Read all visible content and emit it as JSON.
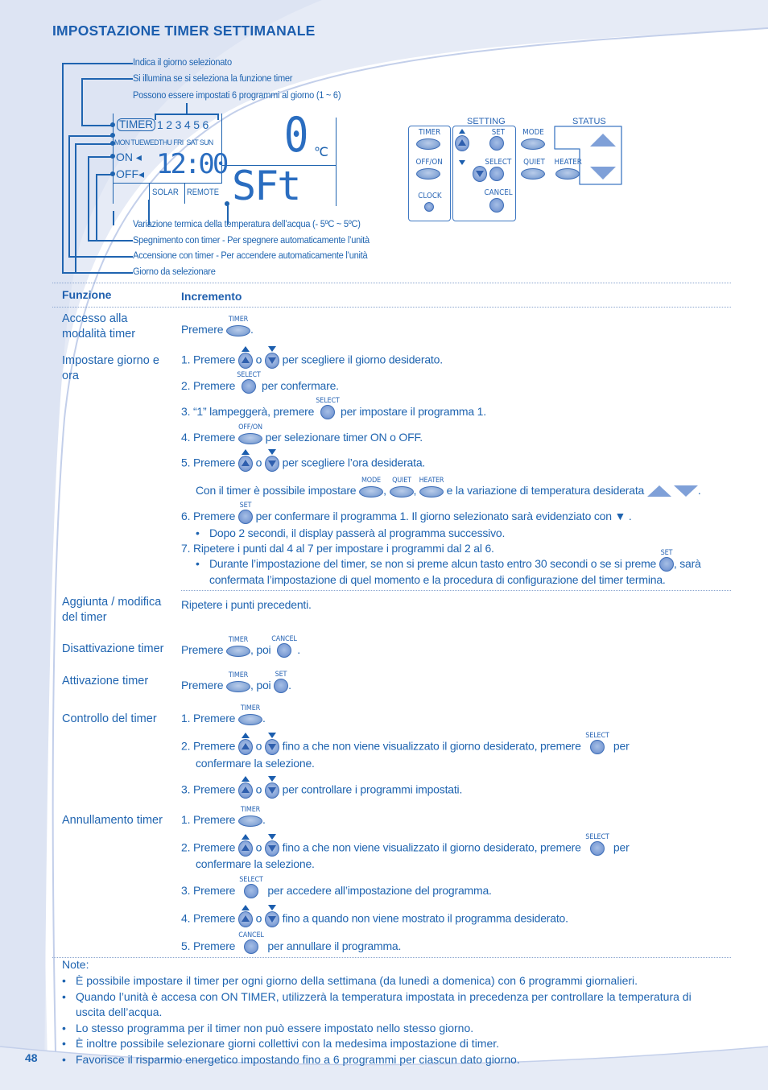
{
  "page": {
    "title": "IMPOSTAZIONE TIMER SETTIMANALE",
    "page_number": "48",
    "accent_color": "#1f64b0"
  },
  "diagram": {
    "callouts_top": [
      "Indica il giorno selezionato",
      "Si illumina se si seleziona la funzione timer",
      "Possono essere impostati 6 programmi al giorno (1 ~ 6)"
    ],
    "callouts_bottom": [
      "Variazione termica della temperatura dell’acqua (- 5ºC ~ 5ºC)",
      "Spegnimento con timer - Per spegnere automaticamente l’unità",
      "Accensione con timer - Per accendere automaticamente l’unità",
      "Giorno da selezionare"
    ],
    "lcd": {
      "timer_label": "TIMER",
      "programs": [
        "1",
        "2",
        "3",
        "4",
        "5",
        "6"
      ],
      "days": [
        "MON",
        "TUE",
        "WED",
        "THU",
        "FRI",
        "SAT",
        "SUN"
      ],
      "on_label": "ON",
      "off_label": "OFF",
      "time": "12:00",
      "temp_value": "0",
      "temp_unit": "℃",
      "mode_text": "SFt",
      "solar_label": "SOLAR",
      "remote_label": "REMOTE"
    },
    "remote": {
      "setting_label": "SETTING",
      "status_label": "STATUS",
      "timer": "TIMER",
      "off_on": "OFF/ON",
      "clock": "CLOCK",
      "set": "SET",
      "select": "SELECT",
      "cancel": "CANCEL",
      "mode": "MODE",
      "quiet": "QUIET",
      "heater": "HEATER"
    }
  },
  "table": {
    "header_function": "Funzione",
    "header_procedure": "Incremento",
    "rows": [
      {
        "function": "Accesso alla modalità timer",
        "steps": {
          "s0_pre": "Premere",
          "s0_post": "."
        }
      },
      {
        "function": "Impostare giorno e ora",
        "steps": {
          "s1_pre": "1.  Premere",
          "s1_mid": "o",
          "s1_post": "per scegliere il giorno desiderato.",
          "s2_pre": "2.  Premere",
          "s2_post": "per confermare.",
          "s3_pre": "3.  “1” lampeggerà, premere",
          "s3_post": "per impostare il programma 1.",
          "s4_pre": "4.  Premere",
          "s4_post": "per selezionare timer ON o OFF.",
          "s5_pre": "5.  Premere",
          "s5_mid": "o",
          "s5_post": "per scegliere l’ora desiderata.",
          "s5b_pre": "Con il timer è possibile impostare",
          "s5b_c1": ",",
          "s5b_c2": ",",
          "s5b_post": "e la variazione di temperatura desiderata",
          "s5b_end": ".",
          "s6_pre": "6.  Premere",
          "s6_post": "per confermare il programma 1. Il giorno selezionato sarà evidenziato con ▼ .",
          "s6_bullet": "Dopo 2 secondi, il display passerà al programma successivo.",
          "s7": "7.  Ripetere i punti dal 4 al 7 per impostare i programmi dal 2 al 6.",
          "s7_bullet_pre": "Durante l’impostazione del timer, se non si preme alcun tasto entro 30 secondi o se si preme",
          "s7_bullet_post": ", sarà",
          "s7_bullet_line2": "confermata l’impostazione di quel momento e la procedura di configurazione del timer termina."
        }
      },
      {
        "function": "Aggiunta / modifica del timer",
        "steps": {
          "s0": "Ripetere i punti precedenti."
        }
      },
      {
        "function": "Disattivazione timer",
        "steps": {
          "s0_pre": "Premere",
          "s0_mid": ", poi",
          "s0_post": "."
        }
      },
      {
        "function": "Attivazione timer",
        "steps": {
          "s0_pre": "Premere",
          "s0_mid": ", poi",
          "s0_post": "."
        }
      },
      {
        "function": "Controllo del timer",
        "steps": {
          "s1_pre": "1.  Premere",
          "s1_post": ".",
          "s2_pre": "2. Premere",
          "s2_mid": "o",
          "s2_post": "fino a che non viene visualizzato il giorno desiderato, premere",
          "s2_end": "per",
          "s2_line2": "confermare la selezione.",
          "s3_pre": "3. Premere",
          "s3_mid": "o",
          "s3_post": "per controllare i programmi impostati."
        }
      },
      {
        "function": "Annullamento timer",
        "steps": {
          "s1_pre": "1.  Premere",
          "s1_post": ".",
          "s2_pre": "2. Premere",
          "s2_mid": "o",
          "s2_post": "fino a che non viene visualizzato il giorno desiderato, premere",
          "s2_end": "per",
          "s2_line2": "confermare la selezione.",
          "s3_pre": "3.  Premere",
          "s3_post": "per accedere all’impostazione del programma.",
          "s4_pre": "4.  Premere",
          "s4_mid": "o",
          "s4_post": "fino a quando non viene mostrato il programma desiderato.",
          "s5_pre": "5.  Premere",
          "s5_post": "per annullare il programma."
        }
      }
    ]
  },
  "notes": {
    "heading": "Note:",
    "bullet": "•",
    "items": [
      "È possibile impostare il timer per ogni giorno della settimana (da lunedì a domenica) con 6 programmi giornalieri.",
      "Quando l’unità è accesa con ON TIMER, utilizzerà la temperatura impostata in precedenza per controllare la temperatura di",
      "uscita dell’acqua.",
      "Lo stesso programma per il timer non può essere impostato nello stesso giorno.",
      "È inoltre possibile selezionare giorni collettivi con la medesima impostazione di timer.",
      "Favorisce il risparmio energetico impostando fino a 6 programmi per ciascun dato giorno."
    ]
  }
}
